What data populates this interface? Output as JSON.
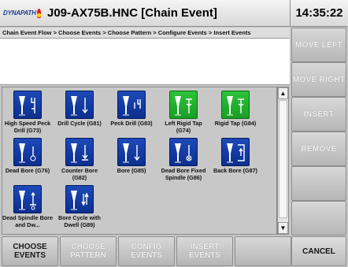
{
  "header": {
    "logo_text": "DYNAPATH",
    "title": "J09-AX75B.HNC   [Chain Event]",
    "clock": "14:35:22"
  },
  "breadcrumb": "Chain Event Flow > Choose Events > Choose Pattern > Configure Events > Insert Events",
  "events": [
    {
      "label": "High Speed Peck Drill (G73)",
      "icon": "high-speed-peck-drill-icon",
      "color": "blue"
    },
    {
      "label": "Drill Cycle (G81)",
      "icon": "drill-cycle-icon",
      "color": "blue"
    },
    {
      "label": "Peck Drill (G83)",
      "icon": "peck-drill-icon",
      "color": "blue"
    },
    {
      "label": "Left Rigid Tap (G74)",
      "icon": "left-rigid-tap-icon",
      "color": "green"
    },
    {
      "label": "Rigid Tap (G84)",
      "icon": "rigid-tap-icon",
      "color": "green"
    },
    {
      "label": "Dead Bore (G76)",
      "icon": "dead-bore-icon",
      "color": "blue"
    },
    {
      "label": "Counter Bore (G82)",
      "icon": "counter-bore-icon",
      "color": "blue"
    },
    {
      "label": "Bore (G85)",
      "icon": "bore-icon",
      "color": "blue"
    },
    {
      "label": "Dead Bore Fixed Spindle (G86)",
      "icon": "dead-bore-fixed-spindle-icon",
      "color": "blue"
    },
    {
      "label": "Back Bore (G87)",
      "icon": "back-bore-icon",
      "color": "blue"
    },
    {
      "label": "Dead Spindle Bore and Dw...",
      "icon": "dead-spindle-bore-icon",
      "color": "blue"
    },
    {
      "label": "Bore Cycle with Dwell (G89)",
      "icon": "bore-cycle-dwell-icon",
      "color": "blue"
    }
  ],
  "side_buttons": [
    "MOVE LEFT",
    "MOVE RIGHT",
    "INSERT",
    "REMOVE",
    "",
    ""
  ],
  "bottom_buttons": [
    "CHOOSE EVENTS",
    "CHOOSE PATTERN",
    "CONFIG EVENTS",
    "INSERT EVENTS",
    ""
  ],
  "cancel": "CANCEL"
}
